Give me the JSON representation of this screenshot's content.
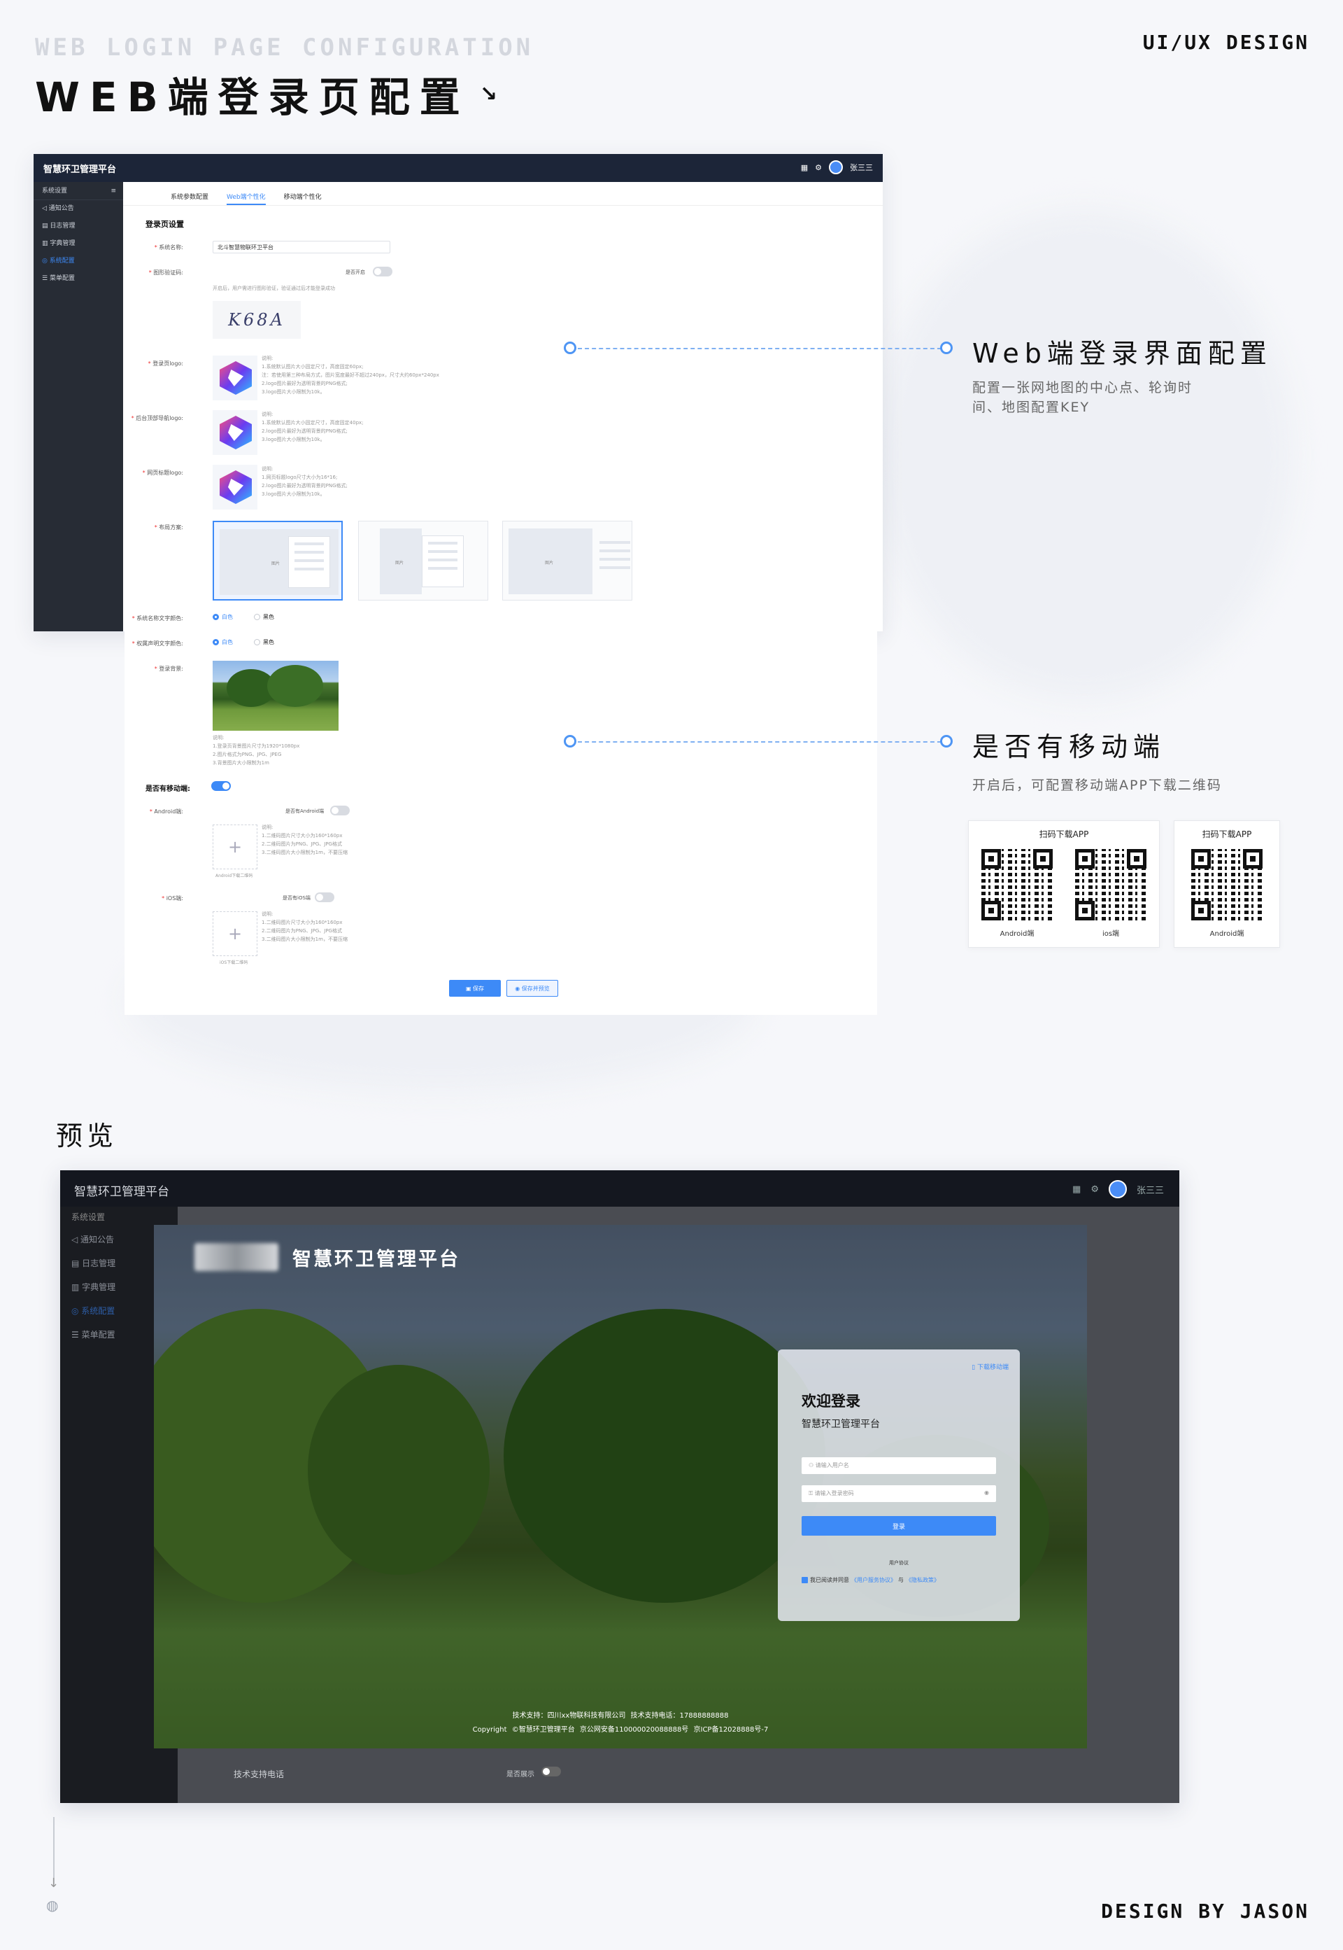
{
  "header": {
    "en_title": "WEB LOGIN PAGE CONFIGURATION",
    "cn_title": "WEB端登录页配置",
    "arrow": "↘",
    "brand": "UI/UX DESIGN"
  },
  "footer": {
    "credit": "DESIGN BY JASON"
  },
  "admin": {
    "app_title": "智慧环卫管理平台",
    "user": "张三三",
    "sidebar": {
      "head": "系统设置",
      "items": [
        "通知公告",
        "日志管理",
        "字典管理",
        "系统配置",
        "菜单配置"
      ],
      "active": 3
    },
    "tabs": [
      "系统参数配置",
      "Web端个性化",
      "移动端个性化"
    ],
    "active_tab": 1
  },
  "form": {
    "section_login": "登录页设置",
    "sys_name_label": "系统名称:",
    "sys_name_value": "北斗智慧物联环卫平台",
    "captcha_label": "图形验证码:",
    "captcha_switch_label": "是否开启",
    "captcha_tip": "开启后，用户需进行图形验证，验证通过后才能登录成功",
    "captcha_code": "K68A",
    "login_logo_label": "登录页logo:",
    "login_logo_tips": [
      "说明:",
      "1.系统默认图片大小固定尺寸，高度固定60px;",
      "注：若使用第三种布局方式，图片宽度最好不超过240px，尺寸大约60px*240px",
      "2.logo图片最好为透明背景的PNG格式;",
      "3.logo图片大小限制为10k。"
    ],
    "admin_logo_label": "后台顶部导航logo:",
    "admin_logo_tips": [
      "说明:",
      "1.系统默认图片大小固定尺寸，高度固定40px;",
      "2.logo图片最好为透明背景的PNG格式;",
      "3.logo图片大小限制为10k。"
    ],
    "tab_logo_label": "网页标题logo:",
    "tab_logo_tips": [
      "说明:",
      "1.网页标题logo尺寸大小为16*16;",
      "2.logo图片最好为透明背景的PNG格式;",
      "3.logo图片大小限制为10k。"
    ],
    "layout_label": "布局方案:",
    "layout_tag": "图片",
    "name_color_label": "系统名称文字颜色:",
    "copyright_color_label": "权属声明文字颜色:",
    "color_options": [
      "白色",
      "黑色"
    ],
    "bg_label": "登录背景:",
    "bg_tips": [
      "说明:",
      "1.登录页背景图片尺寸为1920*1080px",
      "2.图片格式为PNG、JPG、JPEG",
      "3.背景图片大小限制为1m"
    ],
    "mobile_label": "是否有移动端:",
    "android_label": "Android端:",
    "android_switch": "是否有Android端",
    "android_tips": [
      "说明:",
      "1.二维码图片尺寸大小为160*160px",
      "2.二维码图片为PNG、JPG、JPG格式",
      "3.二维码图片大小限制为1m，不要压缩"
    ],
    "android_cap": "Android下载二维码",
    "ios_label": "iOS端:",
    "ios_switch": "是否有iOS端",
    "ios_tips": [
      "说明:",
      "1.二维码图片尺寸大小为160*160px",
      "2.二维码图片为PNG、JPG、JPG格式",
      "3.二维码图片大小限制为1m，不要压缩"
    ],
    "ios_cap": "iOS下载二维码",
    "save": "保存",
    "save_preview": "保存并预览"
  },
  "annotations": {
    "web": {
      "title": "Web端登录界面配置",
      "desc": [
        "配置一张网地图的中心点、轮询时",
        "间、地图配置KEY"
      ]
    },
    "mobile": {
      "title": "是否有移动端",
      "desc": "开启后，可配置移动端APP下载二维码"
    },
    "qr_card_title": "扫码下载APP",
    "qr_android": "Android端",
    "qr_ios": "ios端"
  },
  "preview": {
    "title": "预览",
    "app_title": "智慧环卫管理平台",
    "user": "张三三",
    "sidebar": {
      "head": "系统设置",
      "items": [
        "通知公告",
        "日志管理",
        "字典管理",
        "系统配置",
        "菜单配置"
      ],
      "active": 3
    },
    "scene_brand": "智慧环卫管理平台",
    "login": {
      "download": "下载移动端",
      "welcome": "欢迎登录",
      "sub": "智慧环卫管理平台",
      "user_ph": "请输入用户名",
      "pwd_ph": "请输入登录密码",
      "btn": "登录",
      "agree_title": "用户协议",
      "agree_pre": "我已阅读并同意",
      "agree_link1": "《用户服务协议》",
      "agree_and": "与",
      "agree_link2": "《隐私政策》"
    },
    "footer_l1": "技术支持：四川xx物联科技有限公司   技术支持电话：17888888888",
    "footer_l2": "Copyright ©智慧环卫管理平台   京公网安备110000020088888号   京ICP备12028888号-7",
    "bottom_label": "技术支持电话",
    "bottom_switch": "是否展示"
  }
}
